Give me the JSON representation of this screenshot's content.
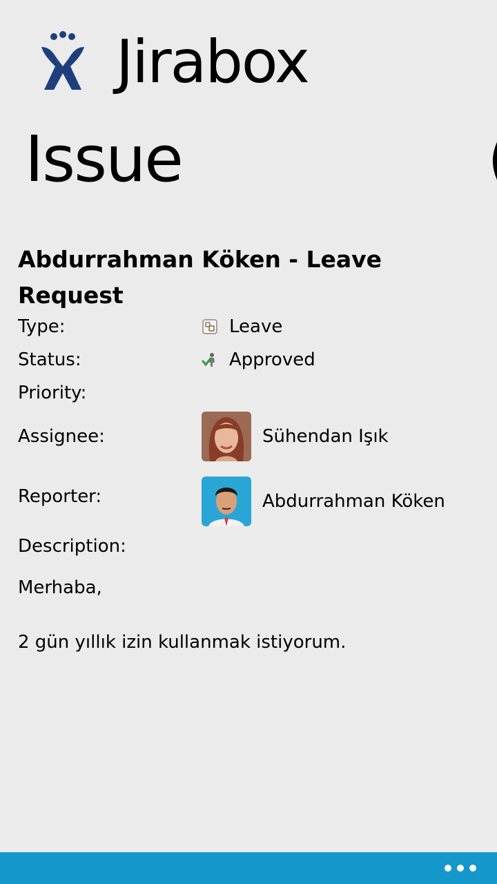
{
  "header": {
    "app_title": "Jirabox",
    "logo_icon": "jira-logo-icon",
    "brand_color": "#1f3f7c"
  },
  "page": {
    "title": "Issue",
    "next_pivot_partial": "("
  },
  "issue": {
    "title": "Abdurrahman Köken - Leave Request",
    "fields": {
      "type_label": "Type:",
      "type_value": "Leave",
      "type_icon": "leave-type-icon",
      "status_label": "Status:",
      "status_value": "Approved",
      "status_icon": "approved-status-icon",
      "priority_label": "Priority:",
      "assignee_label": "Assignee:",
      "assignee_name": "Sühendan Işık",
      "reporter_label": "Reporter:",
      "reporter_name": "Abdurrahman Köken",
      "description_label": "Description:"
    },
    "description_lines": [
      "Merhaba,",
      "2 gün yıllık izin kullanmak istiyorum."
    ]
  },
  "app_bar": {
    "color": "#1497ca",
    "more_icon": "more-dots-icon"
  }
}
